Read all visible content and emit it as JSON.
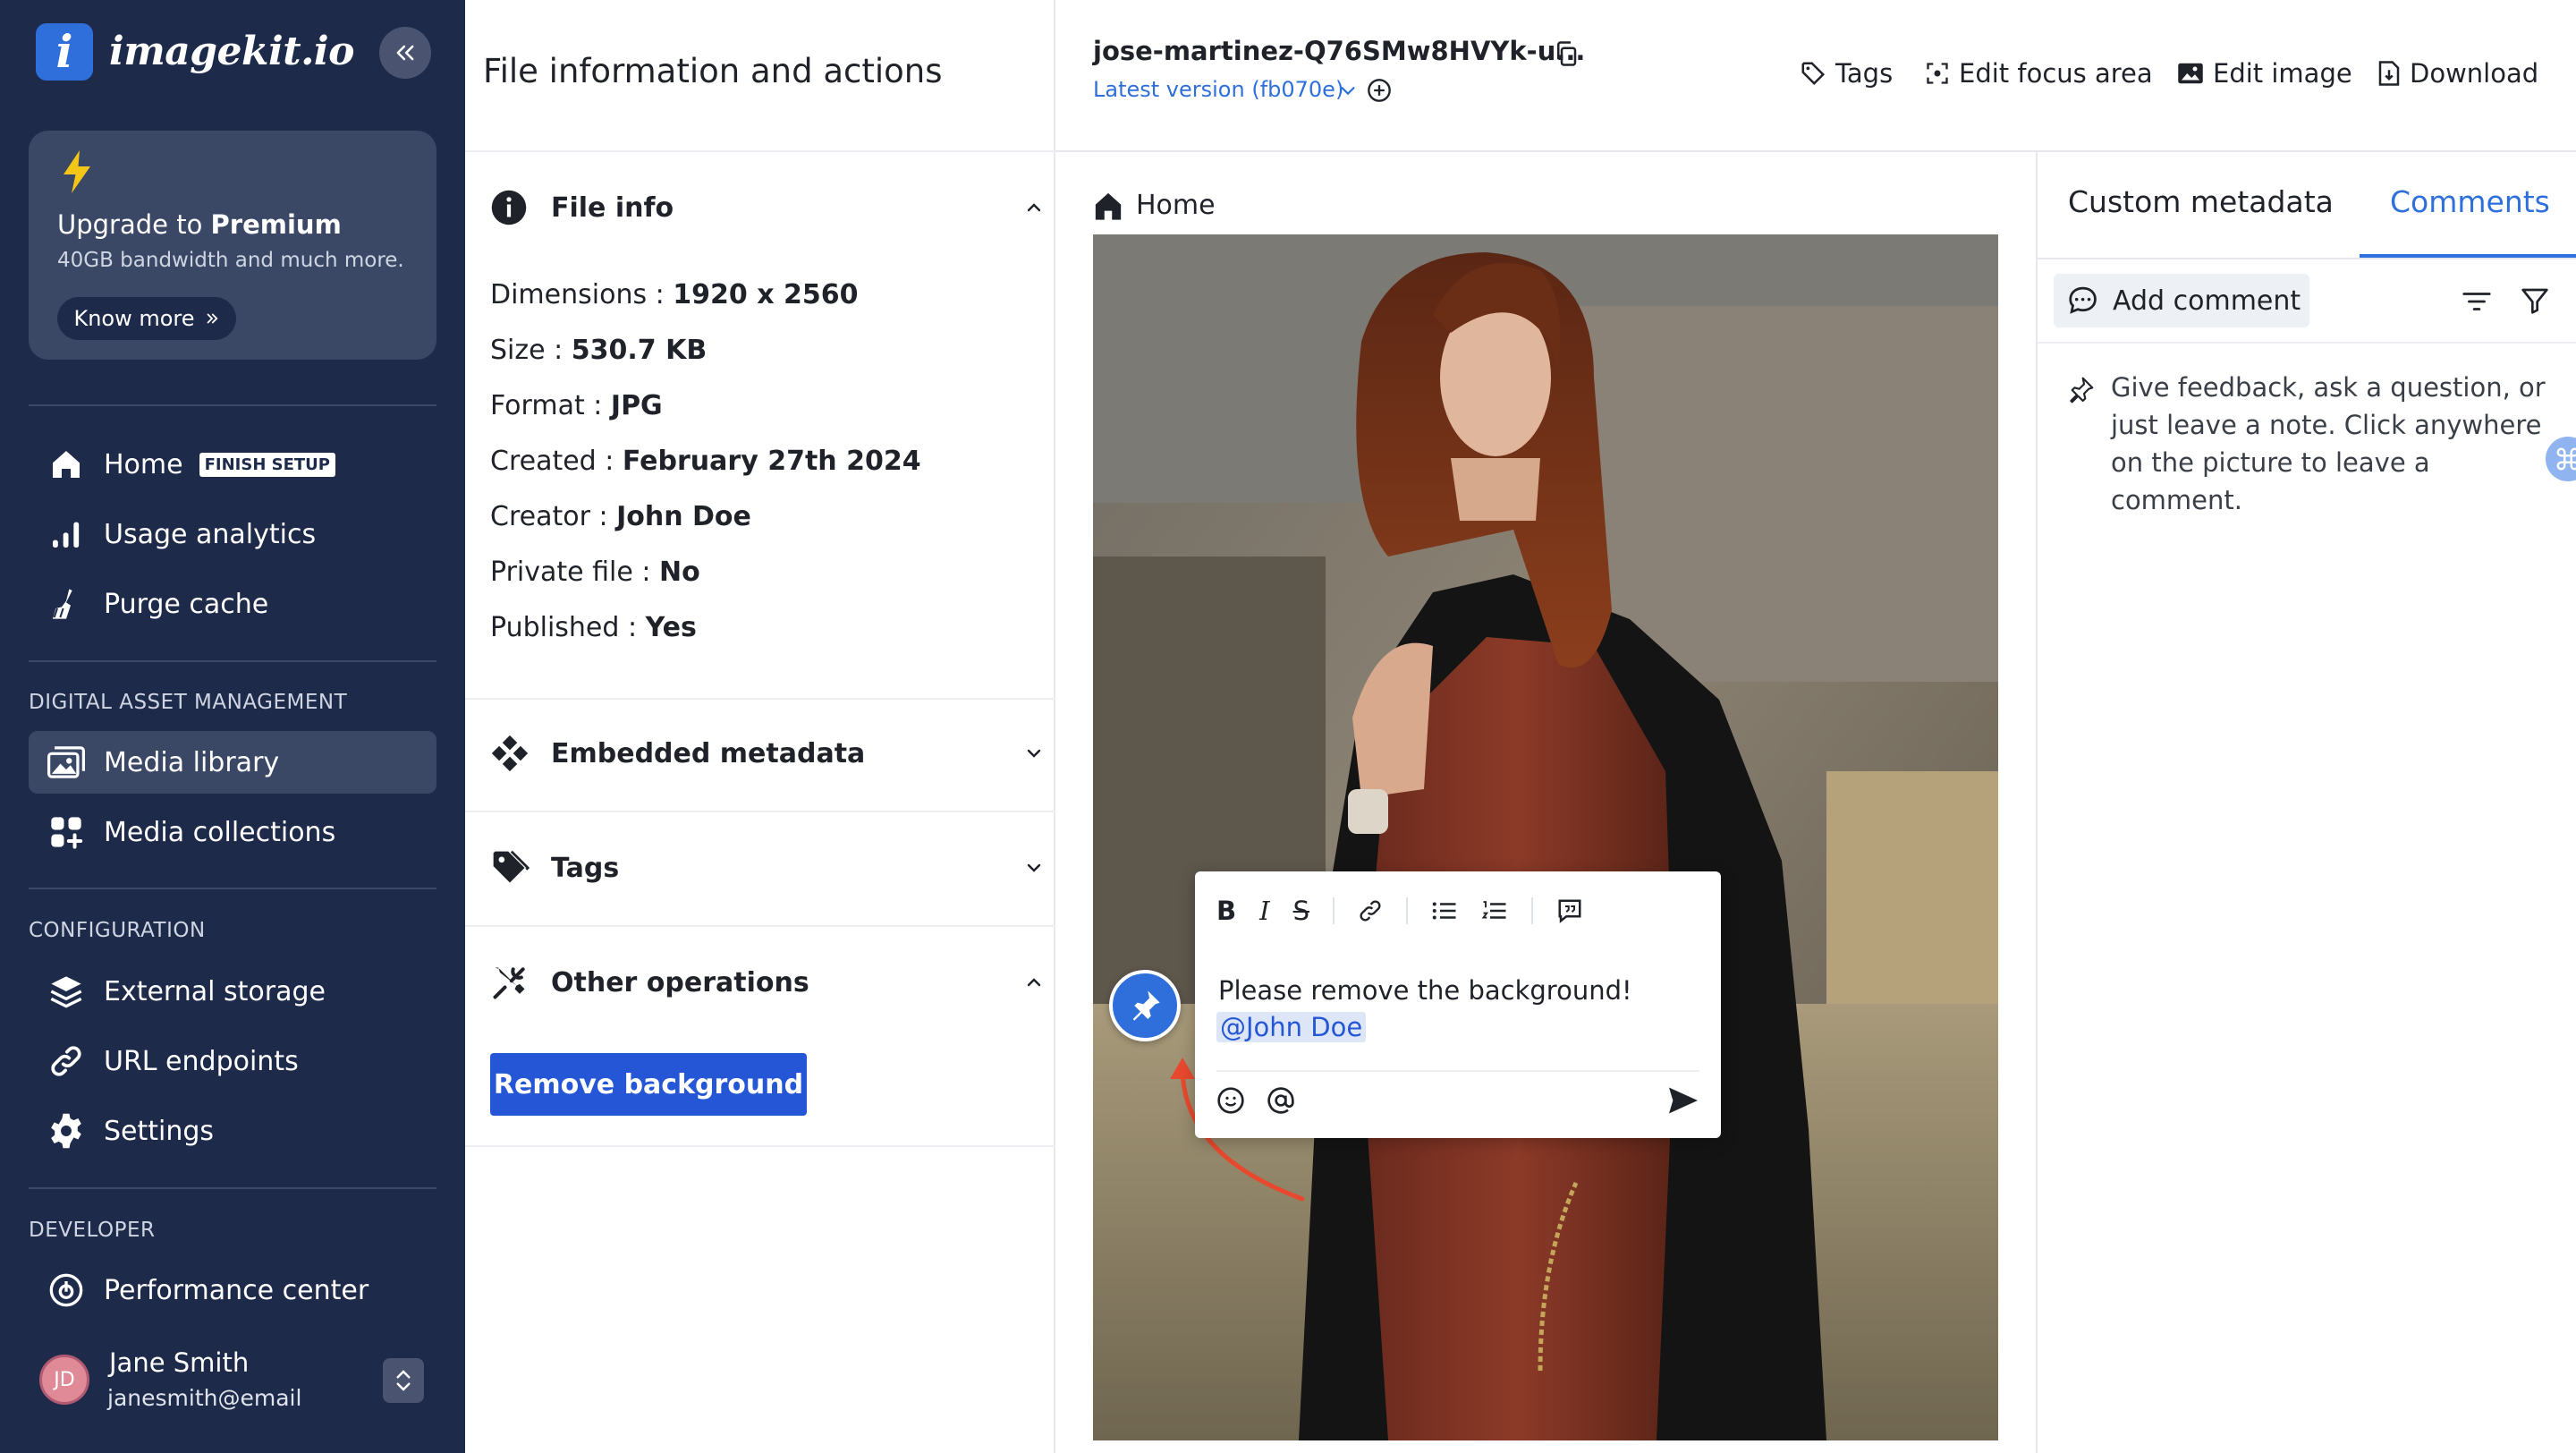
{
  "brand": {
    "logo_letter": "i",
    "name": "imagekit.io"
  },
  "premium": {
    "title_prefix": "Upgrade to ",
    "title_bold": "Premium",
    "subtitle": "40GB bandwidth and much more.",
    "cta": "Know more"
  },
  "nav_main": [
    {
      "label": "Home",
      "badge": "FINISH SETUP",
      "icon": "home-icon"
    },
    {
      "label": "Usage analytics",
      "icon": "bar-chart-icon"
    },
    {
      "label": "Purge cache",
      "icon": "broom-icon"
    }
  ],
  "sections": {
    "dam": "DIGITAL ASSET MANAGEMENT",
    "config": "CONFIGURATION",
    "developer": "DEVELOPER"
  },
  "nav_dam": [
    {
      "label": "Media library",
      "icon": "image-stack-icon",
      "active": true
    },
    {
      "label": "Media collections",
      "icon": "collections-icon"
    }
  ],
  "nav_config": [
    {
      "label": "External storage",
      "icon": "layers-icon"
    },
    {
      "label": "URL endpoints",
      "icon": "link-icon"
    },
    {
      "label": "Settings",
      "icon": "gear-icon"
    }
  ],
  "nav_dev": [
    {
      "label": "Performance center",
      "icon": "gauge-icon"
    }
  ],
  "user": {
    "initials": "JD",
    "name": "Jane Smith",
    "email": "janesmith@email"
  },
  "file_panel": {
    "title": "File information and actions",
    "file_info_label": "File info",
    "info": [
      {
        "key": "Dimensions : ",
        "value": "1920 x 2560"
      },
      {
        "key": "Size : ",
        "value": "530.7 KB"
      },
      {
        "key": "Format : ",
        "value": "JPG"
      },
      {
        "key": "Created : ",
        "value": "February 27th 2024"
      },
      {
        "key": "Creator : ",
        "value": "John Doe"
      },
      {
        "key": "Private file : ",
        "value": "No"
      },
      {
        "key": "Published : ",
        "value": "Yes"
      }
    ],
    "embedded_label": "Embedded metadata",
    "tags_label": "Tags",
    "other_label": "Other operations",
    "remove_bg": "Remove background"
  },
  "topbar": {
    "filename": "jose-martinez-Q76SMw8HVYk-u...",
    "version": "Latest version (fb070e)",
    "actions": {
      "tags": "Tags",
      "focus": "Edit focus area",
      "edit": "Edit image",
      "download": "Download"
    }
  },
  "breadcrumb": {
    "home": "Home"
  },
  "comment_popup": {
    "text": "Please remove the background!",
    "mention": "@John Doe"
  },
  "right_panel": {
    "tab_metadata": "Custom metadata",
    "tab_comments": "Comments",
    "add_comment": "Add comment",
    "hint": "Give feedback, ask a question, or just leave a note. Click anywhere on the picture to leave a comment."
  },
  "colors": {
    "sidebar": "#1e2a4a",
    "accent": "#2f6fdc",
    "primary_button": "#2456d6",
    "arrow": "#e8492e"
  }
}
